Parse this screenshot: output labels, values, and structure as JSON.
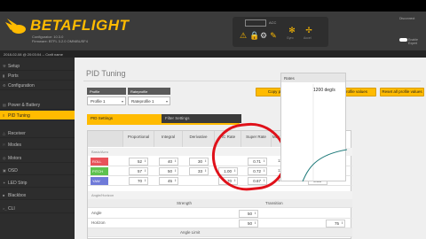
{
  "app": {
    "logo": "BETAFLIGHT",
    "logo_sub_1": "Configurator: 10.3.0",
    "logo_sub_2": "Firmware: BTFL 3.2.0 OMNIBUSF4",
    "status_line": "2018-02-08 @ 20:03:04 -- Craft name"
  },
  "header": {
    "box_label": "ACC",
    "icon_labels": [
      "Gyro",
      "Accel",
      "Mag",
      "Baro"
    ],
    "right_1": "Disconnect",
    "right_2": "Enable Expert"
  },
  "sidebar": {
    "items": [
      {
        "label": "Setup",
        "icon": "wrench-icon",
        "glyph": "⚒",
        "active": false
      },
      {
        "label": "Ports",
        "icon": "plug-icon",
        "glyph": "▮",
        "active": false
      },
      {
        "label": "Configuration",
        "icon": "gear-icon",
        "glyph": "⚙",
        "active": false
      },
      {
        "label": "Power & Battery",
        "icon": "battery-icon",
        "glyph": "▤",
        "active": false
      },
      {
        "label": "PID Tuning",
        "icon": "sliders-icon",
        "glyph": "≡",
        "active": true
      },
      {
        "label": "Receiver",
        "icon": "antenna-icon",
        "glyph": "△",
        "active": false
      },
      {
        "label": "Modes",
        "icon": "flag-icon",
        "glyph": "⚐",
        "active": false
      },
      {
        "label": "Motors",
        "icon": "motor-icon",
        "glyph": "◎",
        "active": false
      },
      {
        "label": "OSD",
        "icon": "display-icon",
        "glyph": "▣",
        "active": false
      },
      {
        "label": "LED Strip",
        "icon": "led-icon",
        "glyph": "✶",
        "active": false
      },
      {
        "label": "Blackbox",
        "icon": "blackbox-icon",
        "glyph": "■",
        "active": false
      },
      {
        "label": "CLI",
        "icon": "terminal-icon",
        "glyph": ">_",
        "active": false
      }
    ]
  },
  "main": {
    "title": "PID Tuning",
    "profile_label": "Profile",
    "profile_value": "Profile 1",
    "rateprofile_label": "Rateprofile",
    "rateprofile_value": "Rateprofile 1",
    "btn_copy_profile": "Copy profile values",
    "btn_copy_rate": "Copy rateprofile values",
    "btn_reset": "Reset all profile values",
    "tab_pid": "PID Settings",
    "tab_filter": "Filter Settings",
    "columns": [
      "Proportional",
      "Integral",
      "Derivative",
      "RC Rate",
      "Super Rate",
      "Max Vel (deg/s)",
      "RC Expo"
    ],
    "section_basic": "Basic/Acro",
    "axes": [
      {
        "name": "ROLL",
        "color": "#e8525a",
        "p": "52",
        "i": "40",
        "d": "30",
        "rc_rate": "",
        "super_rate": "0.71",
        "max_vel": "1101"
      },
      {
        "name": "PITCH",
        "color": "#5ec24e",
        "p": "57",
        "i": "50",
        "d": "33",
        "rc_rate": "1.00",
        "super_rate": "0.72",
        "max_vel": "1113"
      },
      {
        "name": "YAW",
        "color": "#6f7ad8",
        "p": "70",
        "i": "45",
        "d": "",
        "rc_rate": "1.70",
        "super_rate": "0.67",
        "max_vel": "1202"
      }
    ],
    "rc_expo_top": "0.03",
    "rc_expo_bottom": "0.00",
    "section_angle": "Angle/Horizon",
    "col_strength": "Strength",
    "col_transition": "Transition",
    "row_angle": "Angle",
    "row_horizon": "Horizon",
    "angle_strength": "50",
    "horizon_strength": "50",
    "horizon_transition": "75",
    "angle_limit": "Angle Limit"
  },
  "rates_panel": {
    "title": "Rates",
    "value": "1200 deg/s"
  }
}
